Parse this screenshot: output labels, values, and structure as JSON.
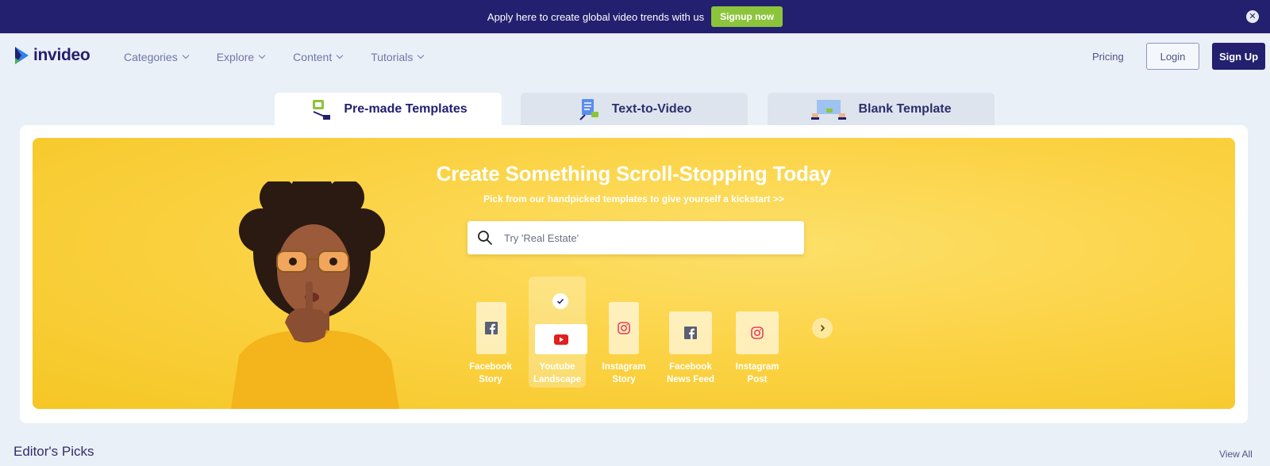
{
  "promo": {
    "text": "Apply here to create global video trends with us",
    "button": "Signup now",
    "close_icon": "close-icon"
  },
  "header": {
    "logo": "invideo",
    "nav": [
      {
        "label": "Categories"
      },
      {
        "label": "Explore"
      },
      {
        "label": "Content"
      },
      {
        "label": "Tutorials"
      }
    ],
    "pricing": "Pricing",
    "login": "Login",
    "signup": "Sign Up"
  },
  "tabs": [
    {
      "label": "Pre-made Templates",
      "active": true
    },
    {
      "label": "Text-to-Video",
      "active": false
    },
    {
      "label": "Blank Template",
      "active": false
    }
  ],
  "hero": {
    "title": "Create Something Scroll-Stopping Today",
    "subtitle": "Pick from our handpicked templates to give yourself a kickstart >>",
    "search_placeholder": "Try 'Real Estate'"
  },
  "formats": [
    {
      "line1": "Facebook",
      "line2": "Story",
      "icon": "facebook-icon",
      "selected": false
    },
    {
      "line1": "Youtube",
      "line2": "Landscape",
      "icon": "youtube-icon",
      "selected": true
    },
    {
      "line1": "Instagram",
      "line2": "Story",
      "icon": "instagram-icon",
      "selected": false
    },
    {
      "line1": "Facebook",
      "line2": "News Feed",
      "icon": "facebook-icon",
      "selected": false
    },
    {
      "line1": "Instagram",
      "line2": "Post",
      "icon": "instagram-icon",
      "selected": false
    }
  ],
  "section": {
    "title": "Editor's Picks",
    "view_all": "View All"
  },
  "colors": {
    "brand_navy": "#22206f",
    "promo_green": "#8cc43c",
    "hero_yellow": "#fbd346",
    "page_bg": "#eaf0f7"
  }
}
